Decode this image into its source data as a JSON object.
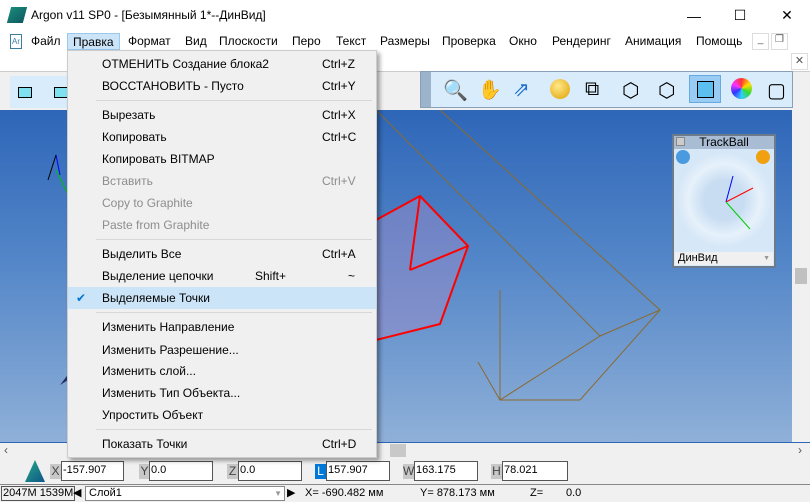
{
  "window": {
    "title": "Argon v11 SP0 - [Безымянный 1*--ДинВид]",
    "minimize": "—",
    "maximize": "☐",
    "close": "✕",
    "doc_close": "✕"
  },
  "menubar": [
    "Файл",
    "Правка",
    "Формат",
    "Вид",
    "Плоскости",
    "Перо",
    "Текст",
    "Размеры",
    "Проверка",
    "Окно",
    "Рендеринг",
    "Анимация",
    "Помощь"
  ],
  "edit_menu": [
    {
      "label": "ОТМЕНИТЬ Создание блока2",
      "shortcut": "Ctrl+Z"
    },
    {
      "label": "ВОССТАНОВИТЬ - Пусто",
      "shortcut": "Ctrl+Y"
    },
    {
      "label": "Вырезать",
      "shortcut": "Ctrl+X"
    },
    {
      "label": "Копировать",
      "shortcut": "Ctrl+C"
    },
    {
      "label": "Копировать BITMAP",
      "shortcut": ""
    },
    {
      "label": "Вставить",
      "shortcut": "Ctrl+V",
      "disabled": true
    },
    {
      "label": "Copy to Graphite",
      "shortcut": "",
      "disabled": true
    },
    {
      "label": "Paste from Graphite",
      "shortcut": "",
      "disabled": true
    },
    {
      "label": "Выделить Все",
      "shortcut": "Ctrl+A"
    },
    {
      "label": "Выделение цепочки",
      "shortcut": "Shift+",
      "shortcut2": "~"
    },
    {
      "label": "Выделяемые Точки",
      "shortcut": "",
      "checked": true
    },
    {
      "label": "Изменить Направление",
      "shortcut": ""
    },
    {
      "label": "Изменить Разрешение...",
      "shortcut": ""
    },
    {
      "label": "Изменить слой...",
      "shortcut": ""
    },
    {
      "label": "Изменить Тип Объекта...",
      "shortcut": ""
    },
    {
      "label": "Упростить Объект",
      "shortcut": ""
    },
    {
      "label": "Показать Точки",
      "shortcut": "Ctrl+D"
    }
  ],
  "trackball": {
    "title": "TrackBall",
    "view": "ДинВид"
  },
  "coords": {
    "x_label": "X",
    "x": "-157.907",
    "y_label": "Y",
    "y": "0.0",
    "z_label": "Z",
    "z": "0.0",
    "l_label": "L",
    "l": "157.907",
    "w_label": "W",
    "w": "163.175",
    "h_label": "H",
    "h": "78.021"
  },
  "status": {
    "memory": "2047M 1539M",
    "layer": "Слой1",
    "x": "X=  -690.482 мм",
    "y": "Y=  878.173 мм",
    "z": "Z=",
    "z_val": "0.0"
  },
  "colors": {
    "accent": "#0078d7",
    "selection": "#ff0000"
  }
}
